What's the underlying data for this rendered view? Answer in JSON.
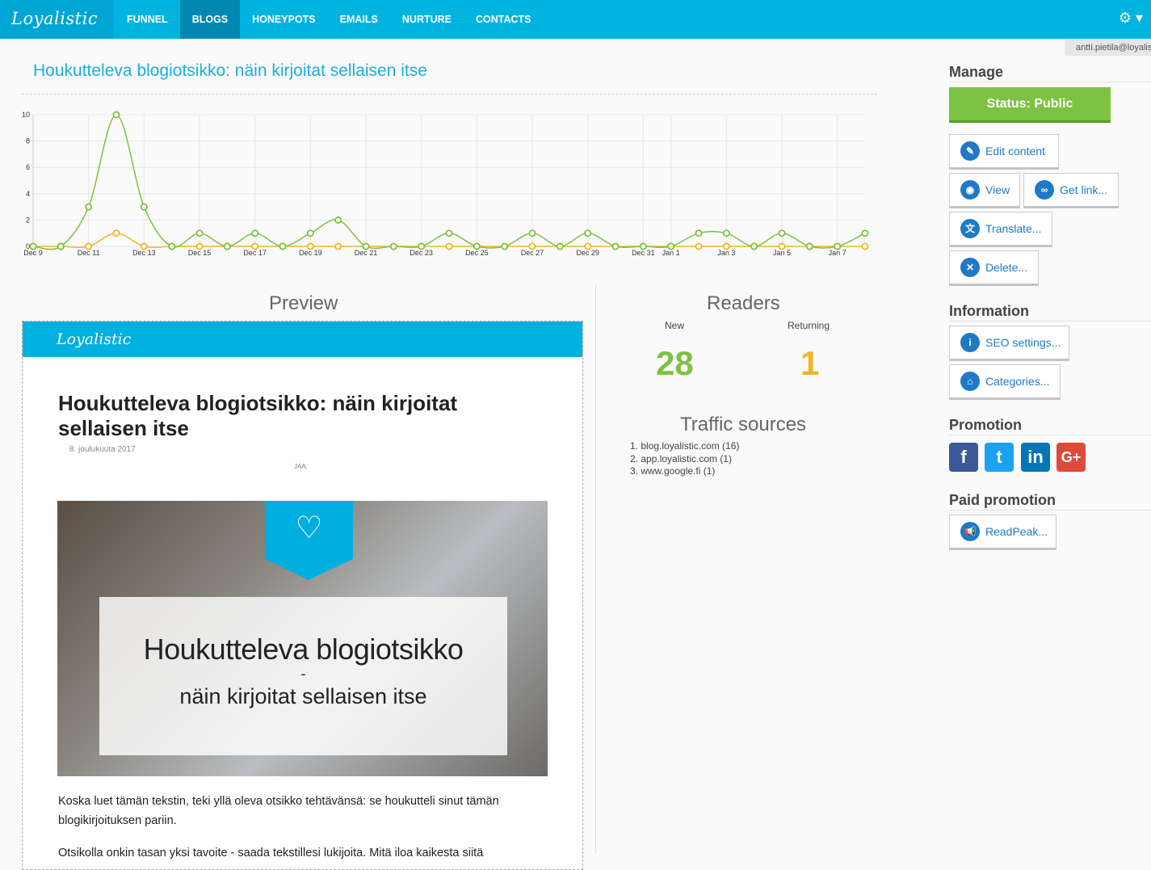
{
  "app": {
    "logo": "Loyalistic",
    "user": "antti.pietila@loyalistic.com"
  },
  "nav": {
    "items": [
      "FUNNEL",
      "BLOGS",
      "HONEYPOTS",
      "EMAILS",
      "NURTURE",
      "CONTACTS"
    ],
    "active": "BLOGS"
  },
  "page": {
    "title": "Houkutteleva blogiotsikko: näin kirjoitat sellaisen itse"
  },
  "chart_data": {
    "type": "line",
    "x": [
      "Dec 9",
      "Dec 10",
      "Dec 11",
      "Dec 12",
      "Dec 13",
      "Dec 14",
      "Dec 15",
      "Dec 16",
      "Dec 17",
      "Dec 18",
      "Dec 19",
      "Dec 20",
      "Dec 21",
      "Dec 22",
      "Dec 23",
      "Dec 24",
      "Dec 25",
      "Dec 26",
      "Dec 27",
      "Dec 28",
      "Dec 29",
      "Dec 30",
      "Dec 31",
      "Jan 1",
      "Jan 2",
      "Jan 3",
      "Jan 4",
      "Jan 5",
      "Jan 6",
      "Jan 7",
      "Jan 8"
    ],
    "tick_labels": [
      "Dec 9",
      "Dec 11",
      "Dec 13",
      "Dec 15",
      "Dec 17",
      "Dec 19",
      "Dec 21",
      "Dec 23",
      "Dec 25",
      "Dec 27",
      "Dec 29",
      "Dec 31",
      "Jan 1",
      "Jan 3",
      "Jan 5",
      "Jan 7"
    ],
    "series": [
      {
        "values": [
          0,
          0,
          3,
          10,
          3,
          0,
          1,
          0,
          1,
          0,
          1,
          2,
          0,
          0,
          0,
          1,
          0,
          0,
          1,
          0,
          1,
          0,
          0,
          0,
          1,
          1,
          0,
          1,
          0,
          0,
          1
        ],
        "color": "#7dc242"
      },
      {
        "values": [
          0,
          0,
          0,
          1,
          0,
          0,
          0,
          0,
          0,
          0,
          0,
          0,
          0,
          0,
          0,
          0,
          0,
          0,
          0,
          0,
          0,
          0,
          0,
          0,
          0,
          0,
          0,
          0,
          0,
          0,
          0
        ],
        "color": "#f0b428"
      }
    ],
    "ylim": [
      0,
      10
    ],
    "yticks": [
      0,
      2,
      4,
      6,
      8,
      10
    ],
    "grid": true
  },
  "preview": {
    "heading": "Preview",
    "logo": "Loyalistic",
    "post_title": "Houkutteleva blogiotsikko: näin kirjoitat sellaisen itse",
    "date": "8. joulukuuta 2017",
    "share": "JAA:",
    "hero_line1": "Houkutteleva blogiotsikko",
    "hero_dash": "-",
    "hero_line2": "näin kirjoitat sellaisen itse",
    "body_p1": "Koska luet tämän tekstin, teki yllä oleva otsikko tehtävänsä: se houkutteli sinut tämän blogikirjoituksen pariin.",
    "body_p2": "Otsikolla onkin tasan yksi tavoite - saada tekstillesi lukijoita. Mitä iloa kaikesta siitä"
  },
  "readers": {
    "heading": "Readers",
    "new_label": "New",
    "new_value": "28",
    "new_color": "#7dc242",
    "returning_label": "Returning",
    "returning_value": "1",
    "returning_color": "#f0b428"
  },
  "traffic": {
    "heading": "Traffic sources",
    "items": [
      "1. blog.loyalistic.com (16)",
      "2. app.loyalistic.com (1)",
      "3. www.google.fi (1)"
    ]
  },
  "manage": {
    "heading": "Manage",
    "status": "Status: Public",
    "edit": "Edit content",
    "view": "View",
    "get_link": "Get link...",
    "translate": "Translate...",
    "delete": "Delete..."
  },
  "information": {
    "heading": "Information",
    "seo": "SEO settings...",
    "categories": "Categories..."
  },
  "promotion": {
    "heading": "Promotion",
    "fb": "f",
    "tw": "t",
    "li": "in",
    "gp": "G+"
  },
  "paid": {
    "heading": "Paid promotion",
    "readpeak": "ReadPeak..."
  }
}
